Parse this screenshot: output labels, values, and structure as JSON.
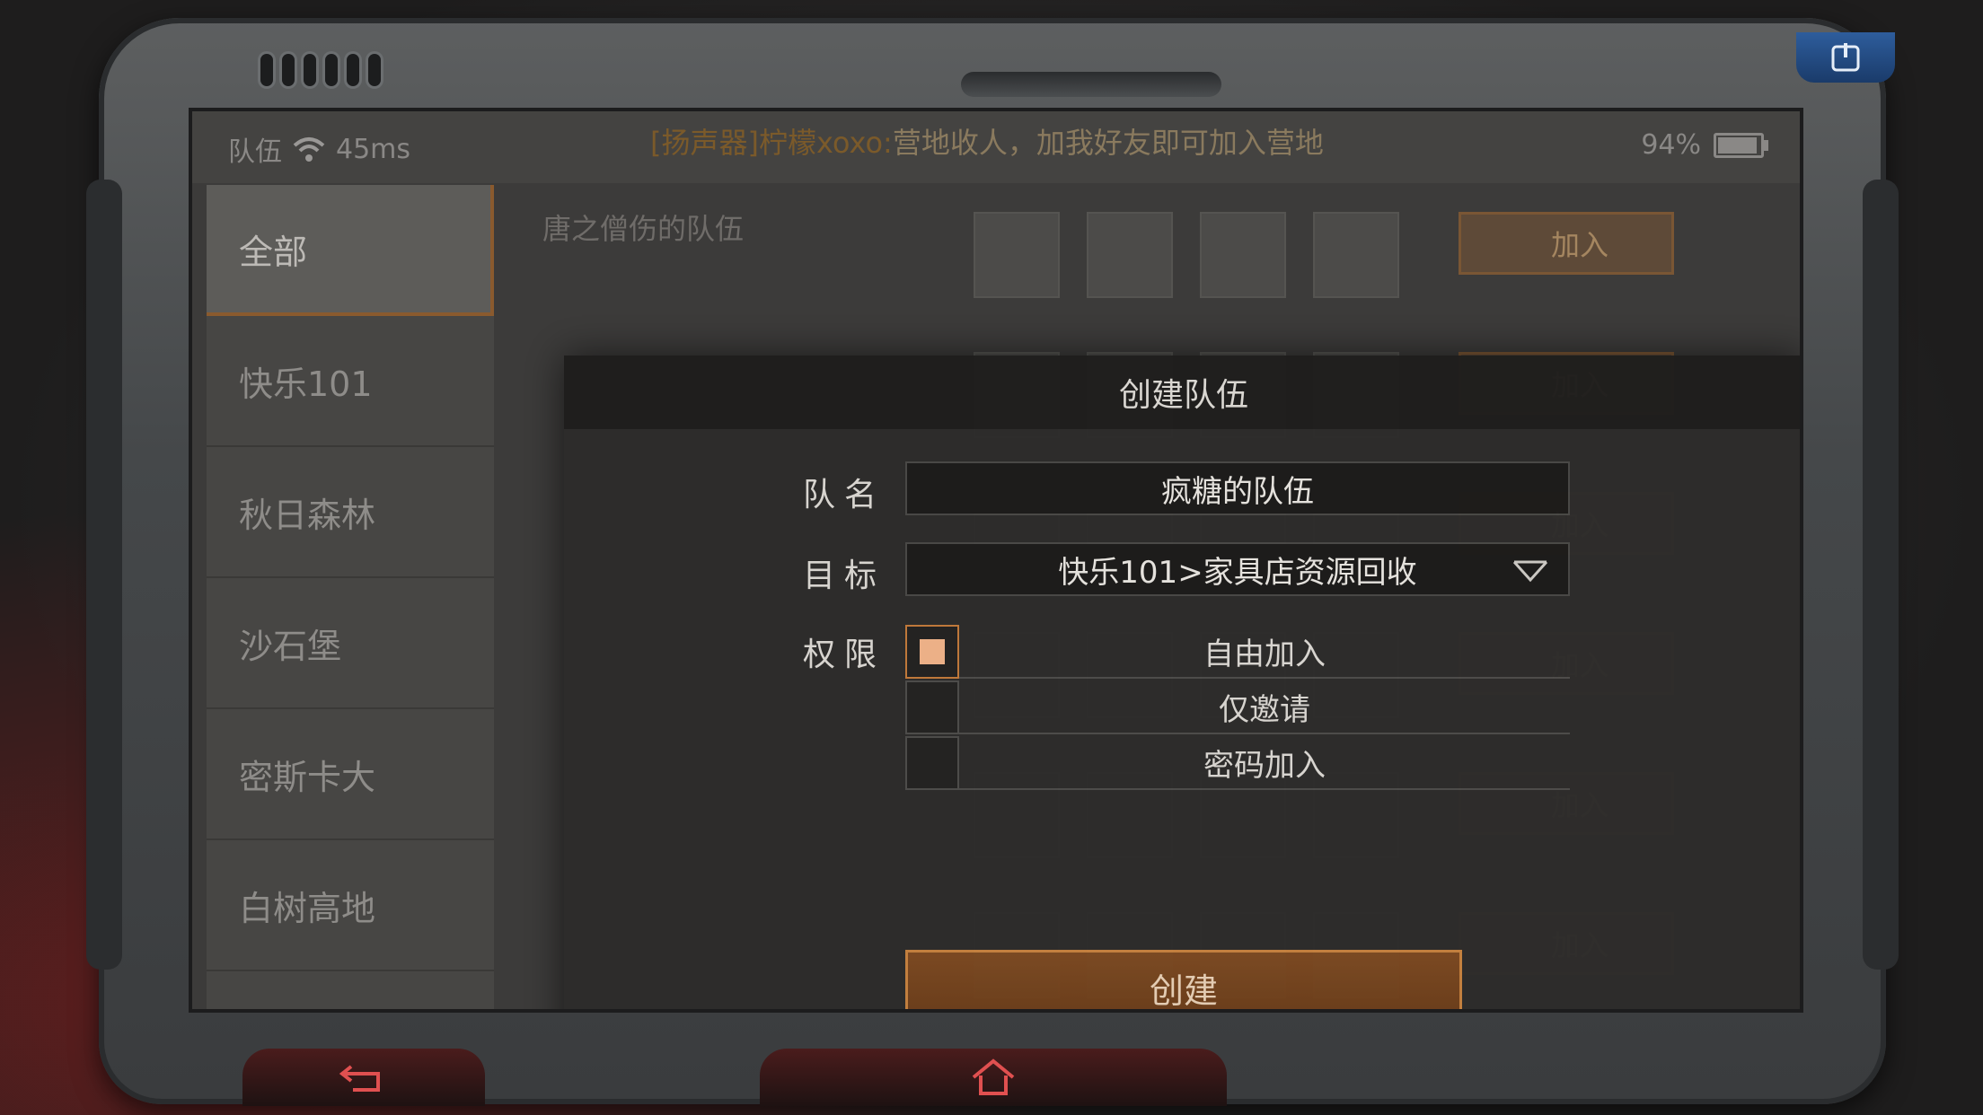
{
  "status_bar": {
    "section": "队伍",
    "ping": "45ms",
    "broadcast_tag": "[扬声器]柠檬xoxo:",
    "broadcast_text": "营地收人，加我好友即可加入营地",
    "battery": "94%",
    "battery_level": 0.94
  },
  "left_nav": {
    "items": [
      {
        "label": "全部",
        "active": true
      },
      {
        "label": "快乐101",
        "active": false
      },
      {
        "label": "秋日森林",
        "active": false
      },
      {
        "label": "沙石堡",
        "active": false
      },
      {
        "label": "密斯卡大",
        "active": false
      },
      {
        "label": "白树高地",
        "active": false
      }
    ]
  },
  "team_list": {
    "rows": [
      {
        "name": "唐之僧伤的队伍",
        "join_label": "加入"
      },
      {
        "name": "",
        "join_label": "加入"
      },
      {
        "name": "",
        "join_label": "加入"
      },
      {
        "name": "",
        "join_label": "加入"
      },
      {
        "name": "",
        "join_label": "加入"
      },
      {
        "name": "",
        "join_label": "加入"
      }
    ]
  },
  "modal": {
    "title": "创建队伍",
    "team_name_label": "队名",
    "team_name_value": "疯糖的队伍",
    "target_label": "目标",
    "target_value": "快乐101>家具店资源回收",
    "permission_label": "权限",
    "options": [
      {
        "label": "自由加入",
        "checked": true
      },
      {
        "label": "仅邀请",
        "checked": false
      },
      {
        "label": "密码加入",
        "checked": false
      }
    ],
    "create_label": "创建"
  },
  "colors": {
    "accent": "#c7823f",
    "button_fill": "#7d4a22",
    "checkbox_fill": "#f2b48a"
  },
  "icons": {
    "wifi": "wifi-icon",
    "power": "power-icon",
    "back": "back-arrow-icon",
    "home": "home-icon",
    "dropdown": "chevron-down-icon"
  }
}
